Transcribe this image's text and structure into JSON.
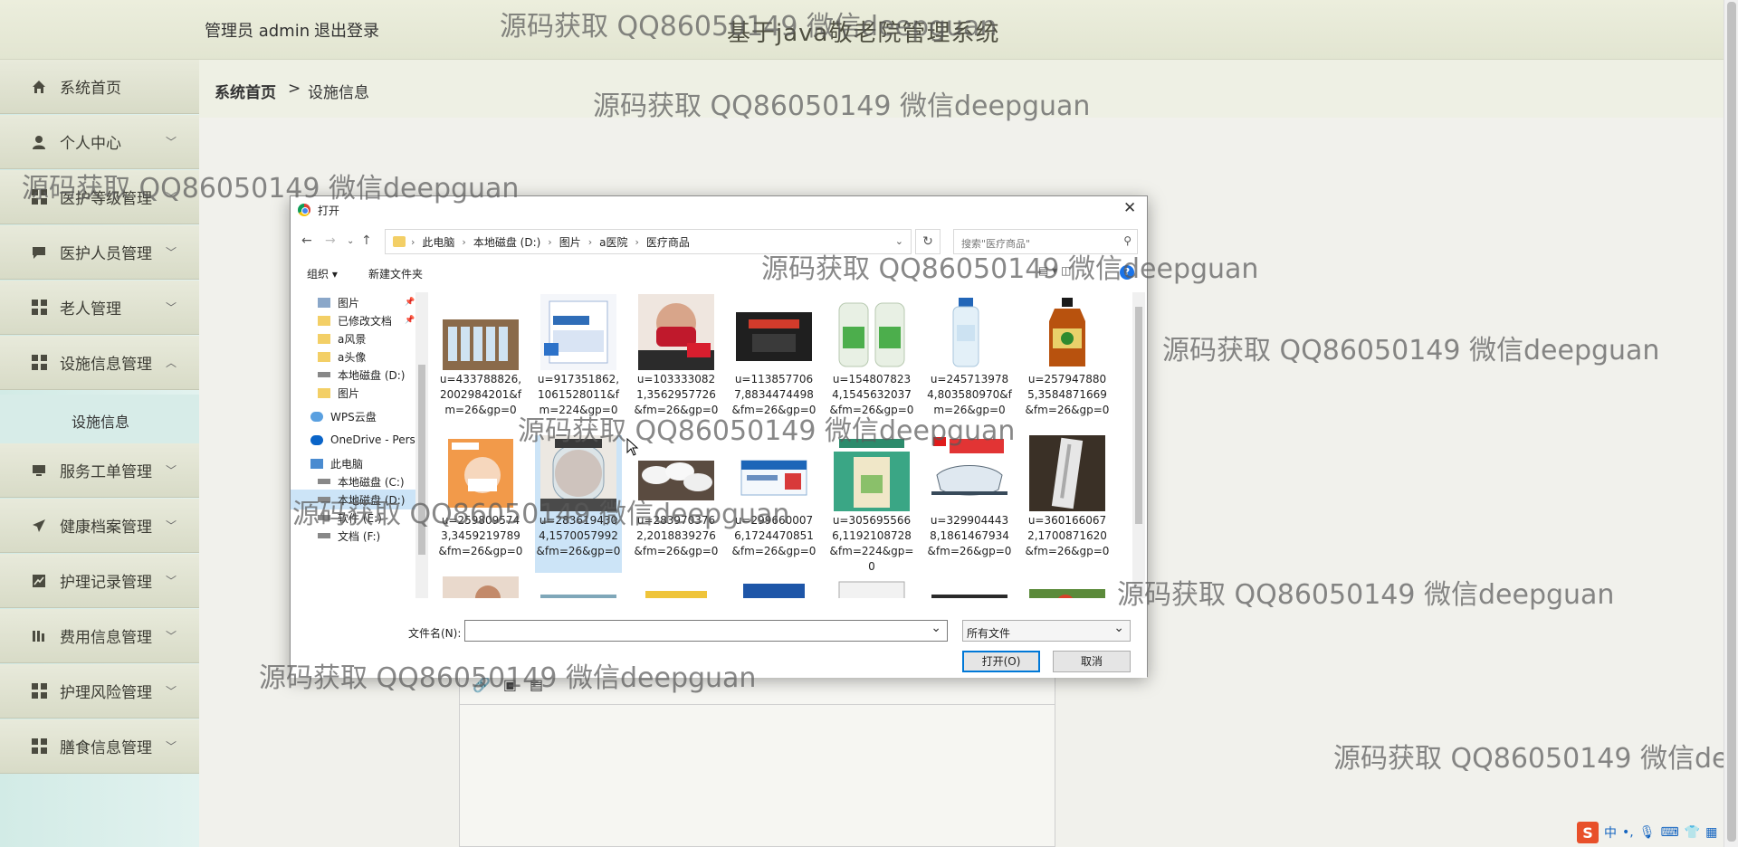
{
  "header": {
    "admin_label": "管理员 admin",
    "logout_label": "退出登录",
    "system_title": "基于java敬老院管理系统"
  },
  "sidebar": {
    "items": [
      {
        "label": "系统首页",
        "icon": "home-icon"
      },
      {
        "label": "个人中心",
        "icon": "user-icon"
      },
      {
        "label": "医护等级管理",
        "icon": "grid-icon"
      },
      {
        "label": "医护人员管理",
        "icon": "chat-icon"
      },
      {
        "label": "老人管理",
        "icon": "grid-icon"
      },
      {
        "label": "设施信息管理",
        "icon": "grid-icon"
      },
      {
        "label": "服务工单管理",
        "icon": "monitor-icon"
      },
      {
        "label": "健康档案管理",
        "icon": "send-icon"
      },
      {
        "label": "护理记录管理",
        "icon": "chart-icon"
      },
      {
        "label": "费用信息管理",
        "icon": "bars-icon"
      },
      {
        "label": "护理风险管理",
        "icon": "grid-icon"
      },
      {
        "label": "膳食信息管理",
        "icon": "grid-icon"
      }
    ],
    "sub_item": "设施信息"
  },
  "breadcrumb": {
    "home": "系统首页",
    "sep": ">",
    "current": "设施信息"
  },
  "watermark": "源码获取 QQ86050149 微信deepguan",
  "dialog": {
    "title": "打开",
    "path": [
      "此电脑",
      "本地磁盘 (D:)",
      "图片",
      "a医院",
      "医疗商品"
    ],
    "search_placeholder": "搜索\"医疗商品\"",
    "organize_label": "组织 ▾",
    "new_folder_label": "新建文件夹",
    "nav_items": [
      {
        "label": "图片",
        "pin": true
      },
      {
        "label": "已修改文档",
        "pin": true
      },
      {
        "label": "a风景",
        "pin": false
      },
      {
        "label": "a头像",
        "pin": false
      },
      {
        "label": "本地磁盘 (D:)",
        "pin": false
      },
      {
        "label": "图片",
        "pin": false
      },
      {
        "label": "WPS云盘",
        "pin": false
      },
      {
        "label": "OneDrive - Pers",
        "pin": false
      },
      {
        "label": "此电脑",
        "pin": false
      },
      {
        "label": "本地磁盘 (C:)",
        "pin": false
      },
      {
        "label": "本地磁盘 (D:)",
        "pin": false
      },
      {
        "label": "软件 (E:)",
        "pin": false
      },
      {
        "label": "文档 (F:)",
        "pin": false
      }
    ],
    "files": [
      "u=433788826,2002984201&fm=26&gp=0",
      "u=917351862,1061528011&fm=224&gp=0",
      "u=1033330821,3562957726&fm=26&gp=0",
      "u=1138577067,8834474498&fm=26&gp=0",
      "u=1548078234,1545632037&fm=26&gp=0",
      "u=2457139784,803580970&fm=26&gp=0",
      "u=2579478805,3584871669&fm=26&gp=0",
      "u=2598095743,3459219789&fm=26&gp=0",
      "u=2836194304,1570057992&fm=26&gp=0",
      "u=2839703762,2018839276&fm=26&gp=0",
      "u=2996600076,1724470851&fm=26&gp=0",
      "u=3056955666,1192108728&fm=224&gp=0",
      "u=3299044438,1861467934&fm=26&gp=0",
      "u=3601660672,1700871620&fm=26&gp=0"
    ],
    "filename_label": "文件名(N):",
    "filename_value": "",
    "filetype_value": "所有文件",
    "open_label": "打开(O)",
    "cancel_label": "取消"
  },
  "ime": {
    "logo": "S",
    "mode": "中"
  }
}
